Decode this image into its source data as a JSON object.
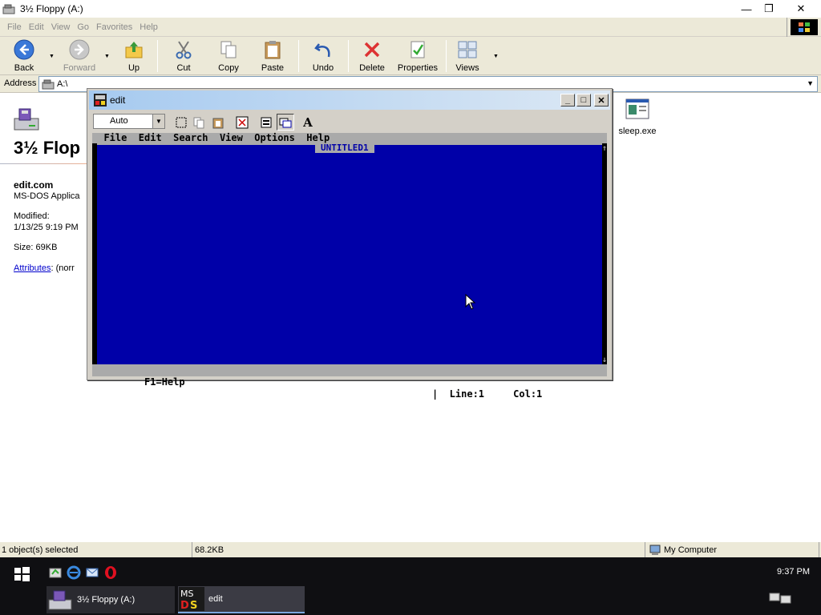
{
  "window": {
    "title": "3½ Floppy (A:)",
    "controls": {
      "minimize": "—",
      "restore": "❐",
      "close": "✕"
    }
  },
  "menu": {
    "items": [
      "File",
      "Edit",
      "View",
      "Go",
      "Favorites",
      "Help"
    ]
  },
  "toolbar": {
    "back": "Back",
    "forward": "Forward",
    "up": "Up",
    "cut": "Cut",
    "copy": "Copy",
    "paste": "Paste",
    "undo": "Undo",
    "delete": "Delete",
    "properties": "Properties",
    "views": "Views",
    "dropdown": "▼"
  },
  "address": {
    "label": "Address",
    "value": "A:\\",
    "arrow": "▼"
  },
  "left_pane": {
    "title": "3½ Flop",
    "filename": "edit.com",
    "filetype": "MS-DOS Applica",
    "modified_label": "Modified:",
    "modified_value": "1/13/25 9:19 PM",
    "size": "Size: 69KB",
    "attributes_link": "Attributes",
    "attributes_value": ": (norr"
  },
  "files": [
    {
      "name": "sleep.exe"
    }
  ],
  "statusbar": {
    "selected": "1 object(s) selected",
    "size": "68.2KB",
    "zone": "My Computer"
  },
  "taskbar": {
    "clock": "9:37 PM",
    "tasks": [
      {
        "label": "3½ Floppy (A:)"
      },
      {
        "label": "edit"
      }
    ]
  },
  "dos_window": {
    "title": "edit",
    "controls": {
      "minimize": "_",
      "maximize": "□",
      "close": "✕"
    },
    "font_select": "Auto",
    "font_arrow": "▼",
    "font_button": "A",
    "menu_line": "  File  Edit  Search  View  Options  Help",
    "document_title": "UNTITLED1",
    "status_left": " F1=Help",
    "status_right": "|  Line:1     Col:1  ",
    "scroll_up": "↑",
    "scroll_down": "↓"
  },
  "colors": {
    "dos_blue": "#0000a8",
    "dos_gray": "#aaaaaa",
    "taskbar": "#0f0f12",
    "chrome": "#ece9d8"
  }
}
